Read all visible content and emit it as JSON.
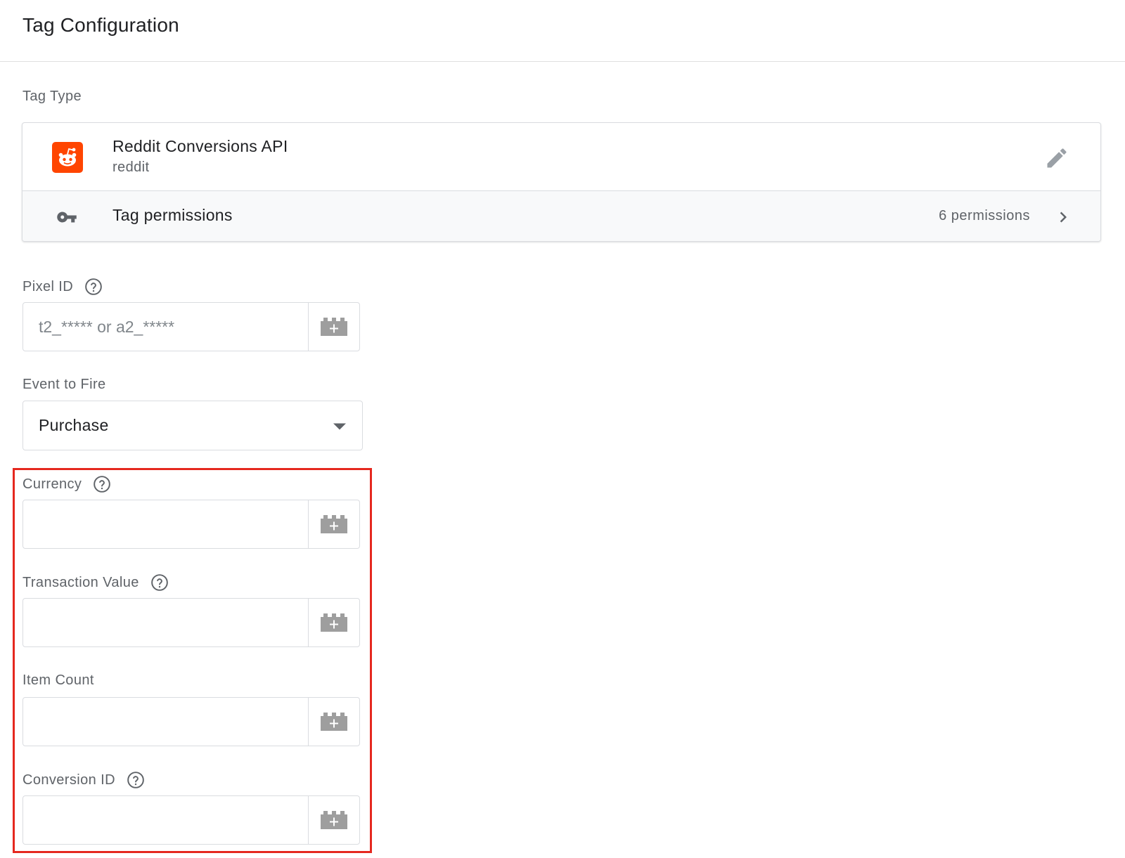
{
  "header": {
    "title": "Tag Configuration"
  },
  "tag_type": {
    "section_label": "Tag Type",
    "name": "Reddit Conversions API",
    "vendor": "reddit",
    "logo_color": "#ff4500",
    "permissions_label": "Tag permissions",
    "permissions_count": "6 permissions"
  },
  "fields": {
    "pixel_id": {
      "label": "Pixel ID",
      "placeholder": "t2_***** or a2_*****",
      "value": ""
    },
    "event": {
      "label": "Event to Fire",
      "value": "Purchase"
    },
    "currency": {
      "label": "Currency",
      "value": ""
    },
    "transaction_value": {
      "label": "Transaction Value",
      "value": ""
    },
    "item_count": {
      "label": "Item Count",
      "value": ""
    },
    "conversion_id": {
      "label": "Conversion ID",
      "value": ""
    }
  },
  "highlight_color": "#e5281f"
}
